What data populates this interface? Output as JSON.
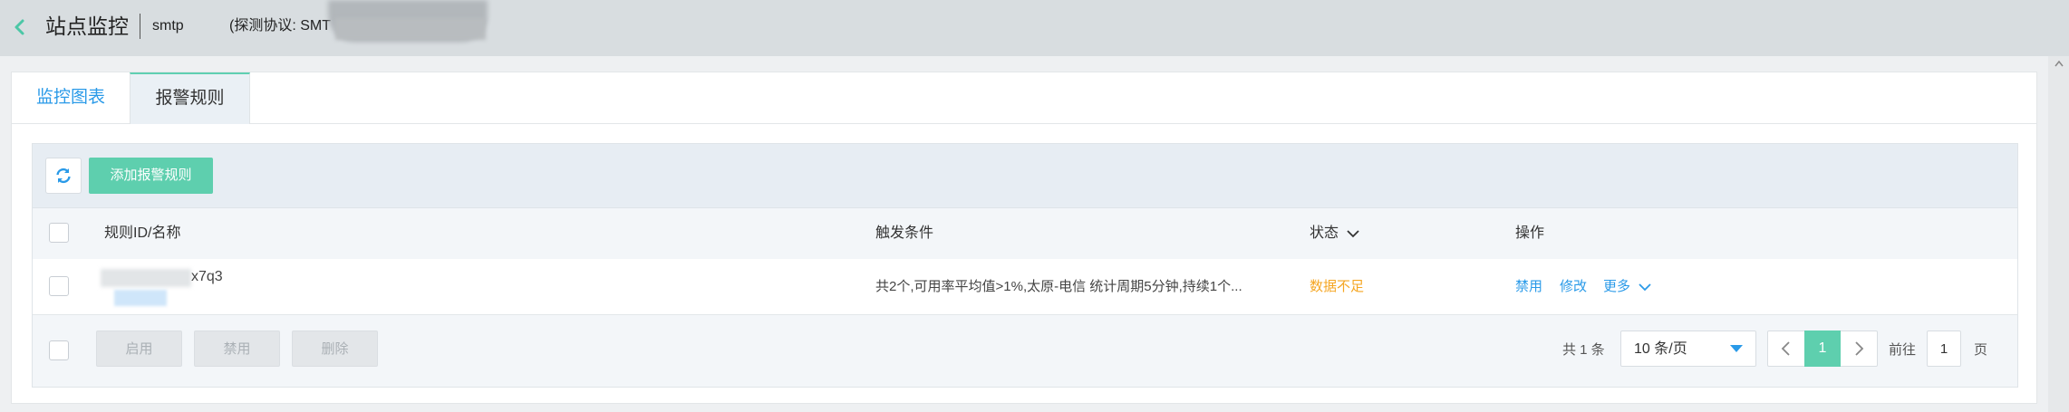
{
  "header": {
    "title": "站点监控",
    "site_name": "smtp",
    "protocol_text": "(探测协议: SMT"
  },
  "tabs": [
    {
      "label": "监控图表",
      "active": false
    },
    {
      "label": "报警规则",
      "active": true
    }
  ],
  "toolbar": {
    "add_rule_label": "添加报警规则"
  },
  "table": {
    "columns": {
      "name": "规则ID/名称",
      "condition": "触发条件",
      "status": "状态",
      "action": "操作"
    },
    "rows": [
      {
        "rule_id_suffix": "x7q3",
        "condition": "共2个,可用率平均值>1%,太原-电信 统计周期5分钟,持续1个...",
        "status": "数据不足",
        "actions": {
          "disable": "禁用",
          "modify": "修改",
          "more": "更多"
        }
      }
    ]
  },
  "footer": {
    "enable_label": "启用",
    "disable_label": "禁用",
    "delete_label": "删除",
    "total_text": "共 1 条",
    "page_size_label": "10 条/页",
    "current_page": "1",
    "goto_label": "前往",
    "goto_value": "1",
    "page_unit": "页"
  },
  "colors": {
    "accent": "#5ecfae",
    "link": "#2a9ae8",
    "warning": "#f5a623",
    "header_bg": "#d8dde0"
  },
  "icons": {
    "back": "chevron-left-icon",
    "refresh": "refresh-icon",
    "status_sort": "chevron-down-icon",
    "more": "chevron-down-icon",
    "page_size": "caret-down-icon",
    "prev": "chevron-left-icon",
    "next": "chevron-right-icon"
  }
}
